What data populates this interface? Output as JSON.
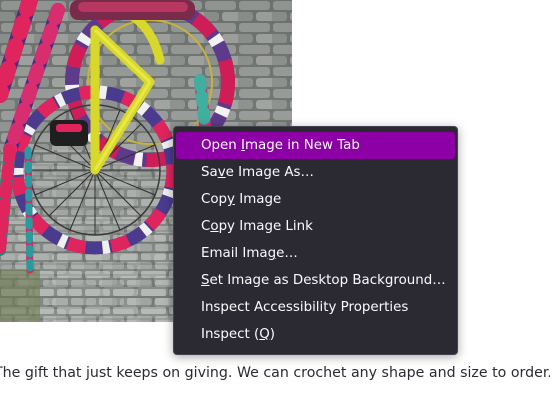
{
  "caption": {
    "text": "The gift that just keeps on giving. We can crochet any shape and size to order. W"
  },
  "context_menu": {
    "items": [
      {
        "before": "Open ",
        "key": "I",
        "after": "mage in New Tab",
        "active": true
      },
      {
        "before": "Sa",
        "key": "v",
        "after": "e Image As…",
        "active": false
      },
      {
        "before": "Cop",
        "key": "y",
        "after": " Image",
        "active": false
      },
      {
        "before": "C",
        "key": "o",
        "after": "py Image Link",
        "active": false
      },
      {
        "before": "Email Ima",
        "key": "g",
        "after": "e…",
        "active": false
      },
      {
        "before": "",
        "key": "S",
        "after": "et Image as Desktop Background…",
        "active": false
      },
      {
        "before": "Inspect Accessibility Properties",
        "key": "",
        "after": "",
        "active": false
      },
      {
        "before": "Inspect (",
        "key": "Q",
        "after": ")",
        "active": false
      }
    ]
  },
  "colors": {
    "menu_background": "#2b2a33",
    "menu_highlight": "#8c00a6",
    "menu_text": "#fbfbfe",
    "caption_text": "#2b2a33"
  }
}
